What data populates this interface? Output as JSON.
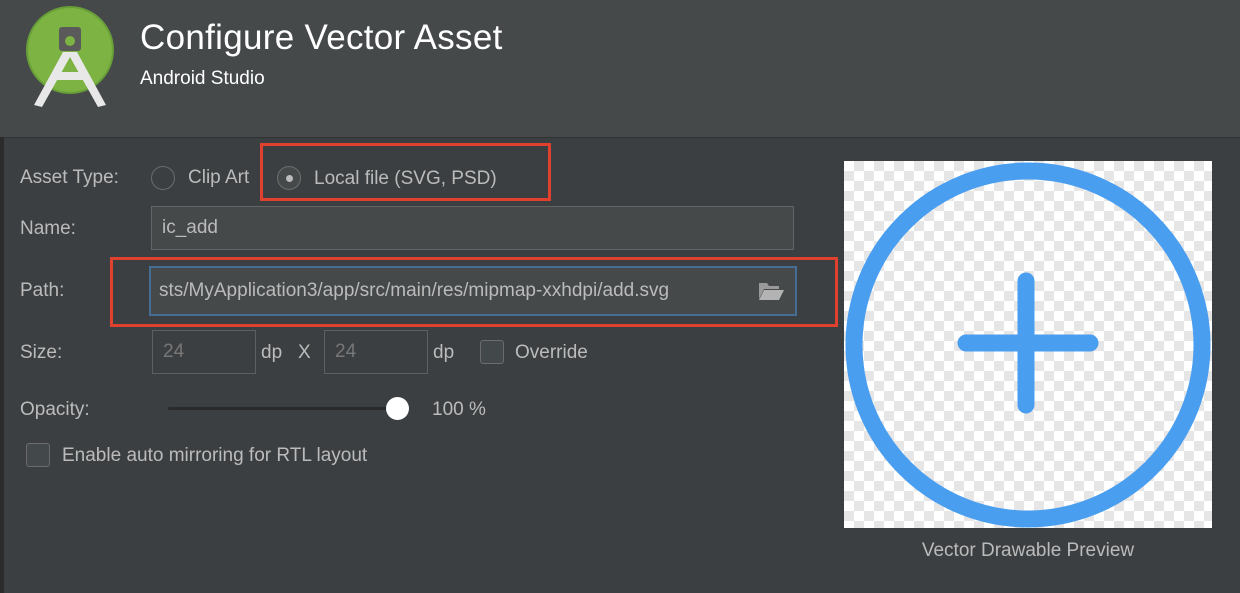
{
  "header": {
    "title": "Configure Vector Asset",
    "subtitle": "Android Studio",
    "logo_icon": "android-studio-logo-icon"
  },
  "form": {
    "asset_type": {
      "label": "Asset Type:",
      "options": [
        {
          "label": "Clip Art",
          "selected": false
        },
        {
          "label": "Local file (SVG, PSD)",
          "selected": true
        }
      ]
    },
    "name": {
      "label": "Name:",
      "value": "ic_add"
    },
    "path": {
      "label": "Path:",
      "value": "sts/MyApplication3/app/src/main/res/mipmap-xxhdpi/add.svg",
      "browse_icon": "folder-open-icon"
    },
    "size": {
      "label": "Size:",
      "width": "24",
      "height": "24",
      "unit": "dp",
      "separator": "X",
      "override_label": "Override",
      "override_checked": false
    },
    "opacity": {
      "label": "Opacity:",
      "value_text": "100 %",
      "value": 100
    },
    "auto_mirror": {
      "label": "Enable auto mirroring for RTL layout",
      "checked": false
    }
  },
  "preview": {
    "caption": "Vector Drawable Preview",
    "icon": "add-circle-icon",
    "icon_color": "#4a9ef0"
  },
  "colors": {
    "highlight": "#e0402e",
    "focus_border": "#466d94",
    "background": "#3c3f41",
    "header_background": "#45494a"
  }
}
